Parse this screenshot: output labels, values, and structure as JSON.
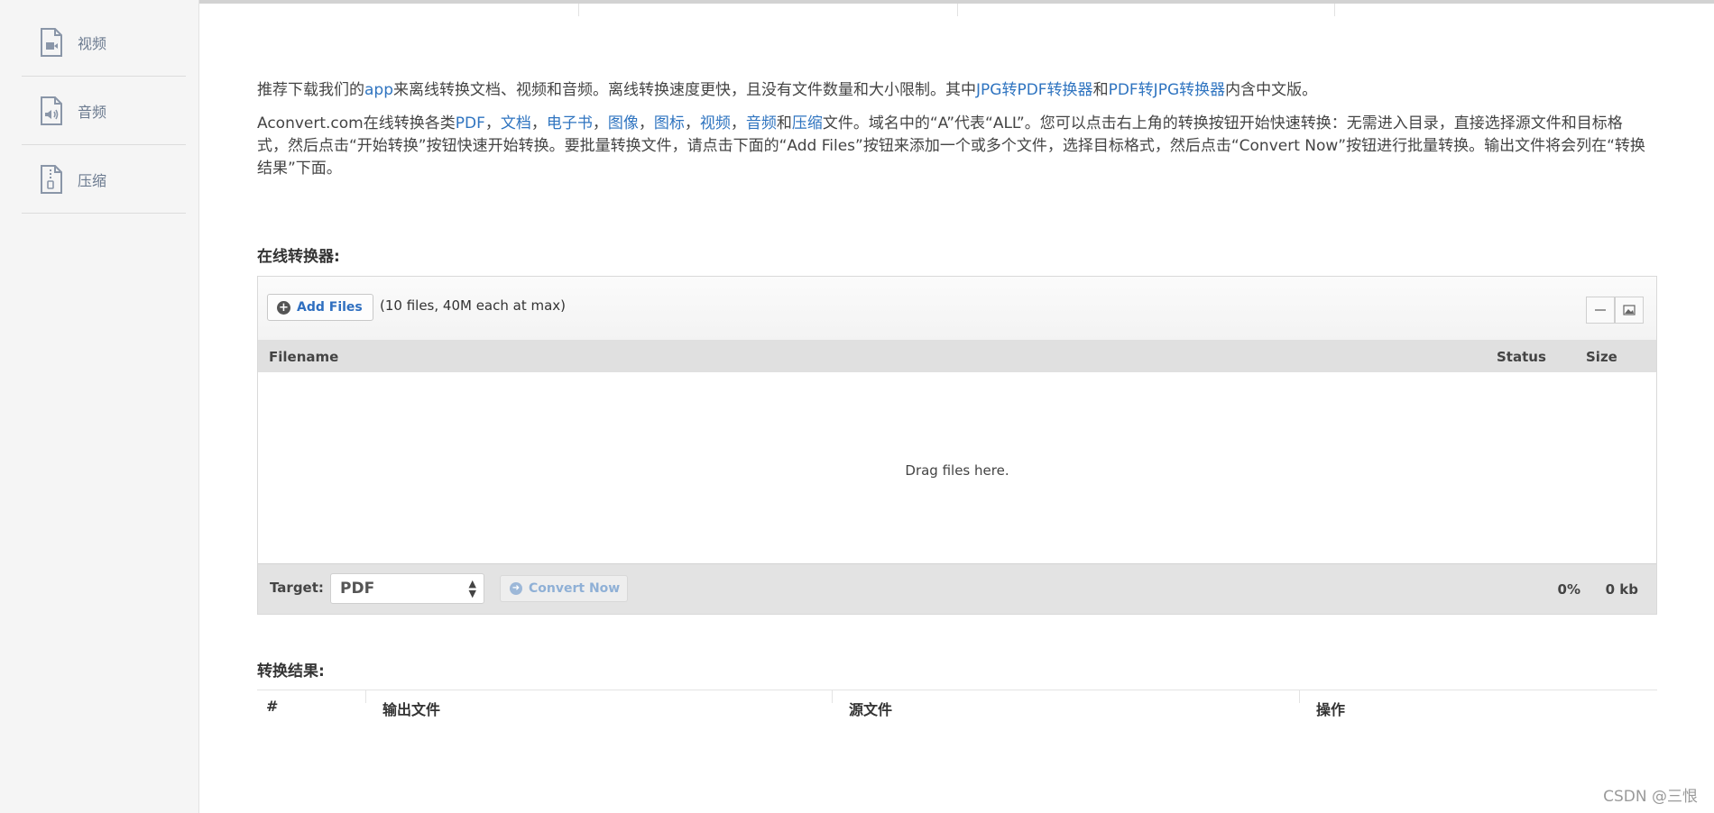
{
  "sidebar": {
    "items": [
      {
        "label": "视频",
        "icon": "video-file-icon"
      },
      {
        "label": "音频",
        "icon": "audio-file-icon"
      },
      {
        "label": "压缩",
        "icon": "archive-file-icon"
      }
    ]
  },
  "intro": {
    "line1": {
      "t1": "推荐下载我们的",
      "app": "app",
      "t2": "来离线转换文档、视频和音频。离线转换速度更快，且没有文件数量和大小限制。其中",
      "jpg_pdf": "JPG转PDF转换器",
      "t3": "和",
      "pdf_jpg": "PDF转JPG转换器",
      "t4": "内含中文版。"
    },
    "line2": {
      "t1": "Aconvert.com在线转换各类",
      "pdf": "PDF",
      "s1": "，",
      "doc": "文档",
      "s2": "，",
      "ebook": "电子书",
      "s3": "，",
      "image": "图像",
      "s4": "，",
      "icon": "图标",
      "s5": "，",
      "video": "视频",
      "s6": "，",
      "audio": "音频",
      "and": "和",
      "archive": "压缩",
      "t2": "文件。域名中的“A”代表“ALL”。您可以点击右上角的转换按钮开始快速转换：无需进入目录，直接选择源文件和目标格式，然后点击“开始转换”按钮快速开始转换。要批量转换文件，请点击下面的“Add Files”按钮来添加一个或多个文件，选择目标格式，然后点击“Convert Now”按钮进行批量转换。输出文件将会列在“转换结果”下面。"
    }
  },
  "online_heading": "在线转换器:",
  "uploader": {
    "add_files": "Add Files",
    "limit": "(10 files, 40M each at max)",
    "columns": {
      "filename": "Filename",
      "status": "Status",
      "size": "Size"
    },
    "drop_text": "Drag files here.",
    "target_label": "Target:",
    "target_value": "PDF",
    "convert_now": "Convert Now",
    "progress": "0%",
    "total_size": "0 kb"
  },
  "result_heading": "转换结果:",
  "result_table": {
    "columns": [
      "#",
      "输出文件",
      "源文件",
      "操作"
    ]
  },
  "watermark": "CSDN @三恨",
  "colors": {
    "link": "#2f74c0",
    "sidebar_bg": "#f5f5f5",
    "table_header": "#e0e0e0"
  }
}
